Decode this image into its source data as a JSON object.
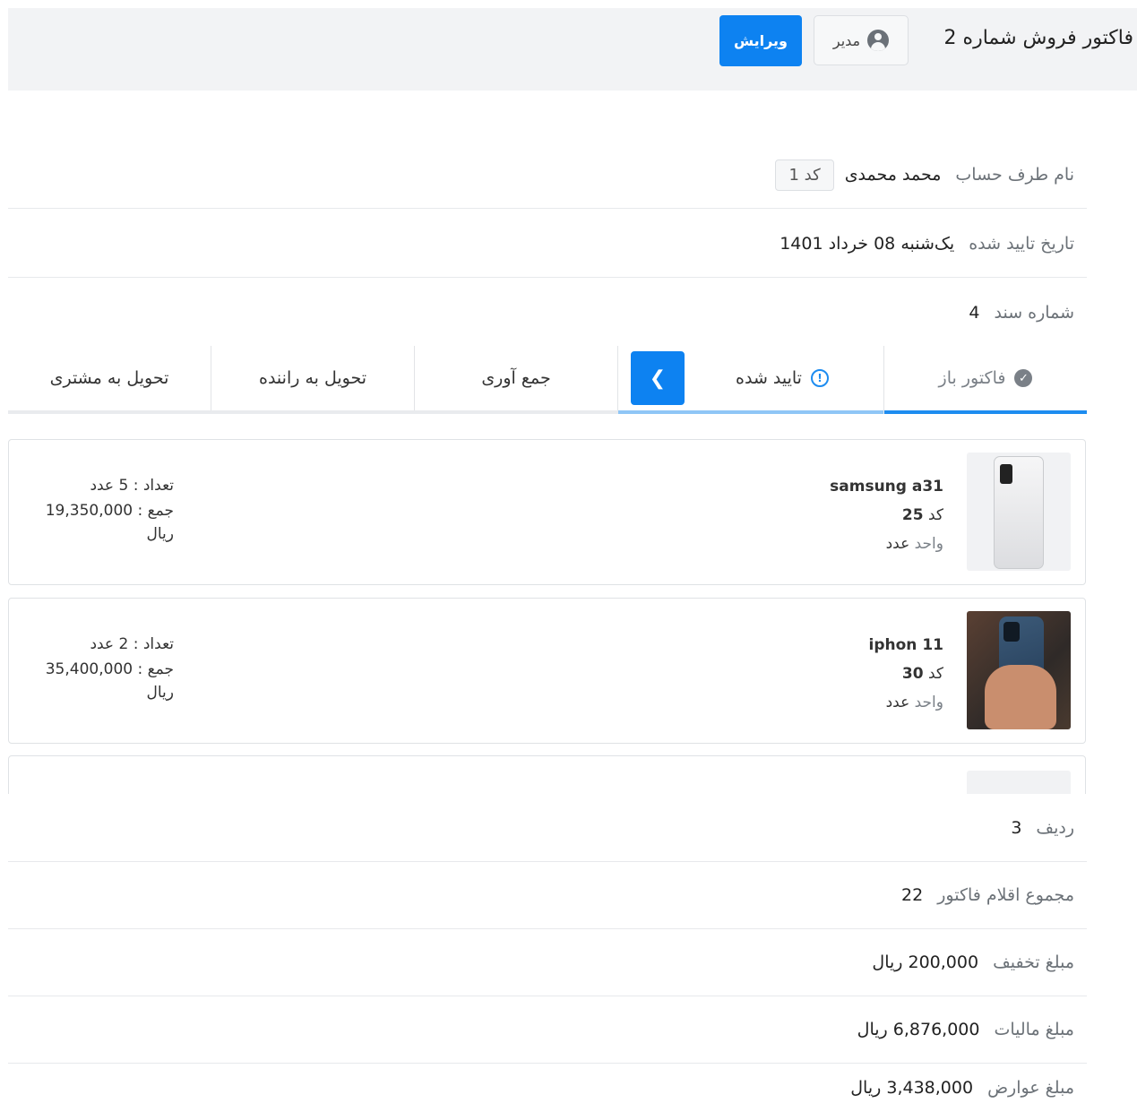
{
  "header": {
    "title": "فاکتور فروش شماره 2",
    "role_label": "مدیر",
    "edit_label": "ویرایش"
  },
  "info": {
    "account": {
      "label": "نام طرف حساب",
      "value": "محمد محمدی",
      "code": "کد 1"
    },
    "date": {
      "label": "تاریخ تایید شده",
      "value": "یک‌شنبه 08 خرداد 1401"
    },
    "doc_number": {
      "label": "شماره سند",
      "value": "4"
    }
  },
  "steps": [
    {
      "label": "فاکتور باز",
      "state": "done"
    },
    {
      "label": "تایید شده",
      "state": "current"
    },
    {
      "label": "جمع آوری",
      "state": "pending"
    },
    {
      "label": "تحویل به راننده",
      "state": "pending"
    },
    {
      "label": "تحویل به مشتری",
      "state": "pending"
    }
  ],
  "items": [
    {
      "name": "samsung a31",
      "code_label": "کد",
      "code": "25",
      "unit_label": "واحد",
      "unit": "عدد",
      "qty": "تعداد : 5 عدد",
      "sum": "جمع : 19,350,000",
      "currency": "ریال"
    },
    {
      "name": "iphon 11",
      "code_label": "کد",
      "code": "30",
      "unit_label": "واحد",
      "unit": "عدد",
      "qty": "تعداد : 2 عدد",
      "sum": "جمع : 35,400,000",
      "currency": "ریال"
    }
  ],
  "summary": {
    "row": {
      "label": "ردیف",
      "value": "3"
    },
    "total_items": {
      "label": "مجموع اقلام فاکتور",
      "value": "22"
    },
    "discount": {
      "label": "مبلغ تخفیف",
      "value": "200,000 ریال"
    },
    "tax": {
      "label": "مبلغ مالیات",
      "value": "6,876,000 ریال"
    },
    "duties": {
      "label": "مبلغ عوارض",
      "value": "3,438,000 ریال"
    }
  },
  "colors": {
    "accent": "#0d82f1",
    "progress_done": "#1d8cf0",
    "progress_current": "#8fc6f6",
    "header_bg": "#f2f3f5"
  }
}
